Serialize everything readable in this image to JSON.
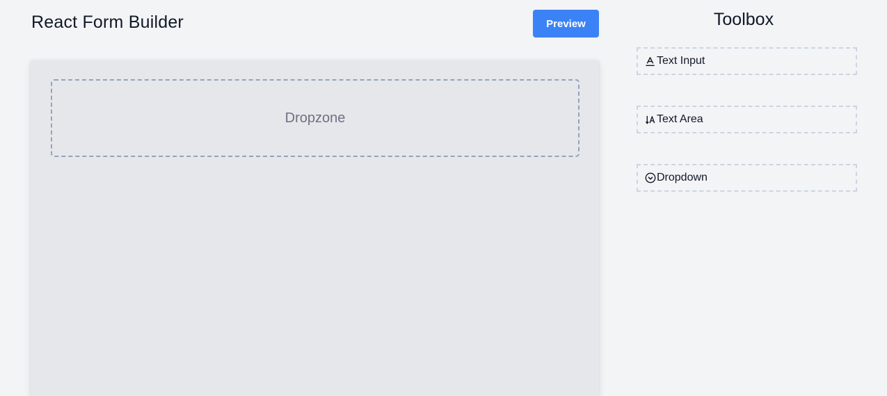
{
  "header": {
    "title": "React Form Builder",
    "preview_label": "Preview"
  },
  "canvas": {
    "dropzone_label": "Dropzone"
  },
  "toolbox": {
    "title": "Toolbox",
    "items": [
      {
        "label": "Text Input",
        "icon": "text-input-icon"
      },
      {
        "label": "Text Area",
        "icon": "text-area-icon"
      },
      {
        "label": "Dropdown",
        "icon": "dropdown-icon"
      }
    ]
  },
  "colors": {
    "accent": "#3b82f6",
    "background": "#f3f4f6",
    "canvas": "#e5e7eb"
  }
}
